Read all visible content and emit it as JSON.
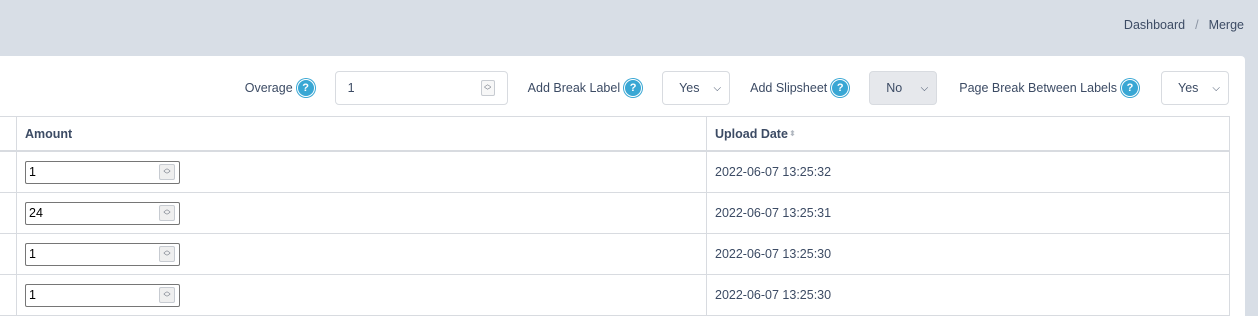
{
  "breadcrumb": {
    "items": [
      "Dashboard",
      "Merge"
    ],
    "separator": "/"
  },
  "options": {
    "overage": {
      "label": "Overage",
      "value": "1"
    },
    "add_break_label": {
      "label": "Add Break Label",
      "value": "Yes"
    },
    "add_slipsheet": {
      "label": "Add Slipsheet",
      "value": "No"
    },
    "page_break": {
      "label": "Page Break Between Labels",
      "value": "Yes"
    },
    "help_glyph": "?"
  },
  "table": {
    "columns": [
      "Amount",
      "Upload Date"
    ],
    "rows": [
      {
        "amount": "1",
        "upload_date": "2022-06-07 13:25:32"
      },
      {
        "amount": "24",
        "upload_date": "2022-06-07 13:25:31"
      },
      {
        "amount": "1",
        "upload_date": "2022-06-07 13:25:30"
      },
      {
        "amount": "1",
        "upload_date": "2022-06-07 13:25:30"
      }
    ]
  },
  "colors": {
    "background": "#d8dee6",
    "help_icon": "#39a7d4",
    "text": "#3c4b64"
  }
}
